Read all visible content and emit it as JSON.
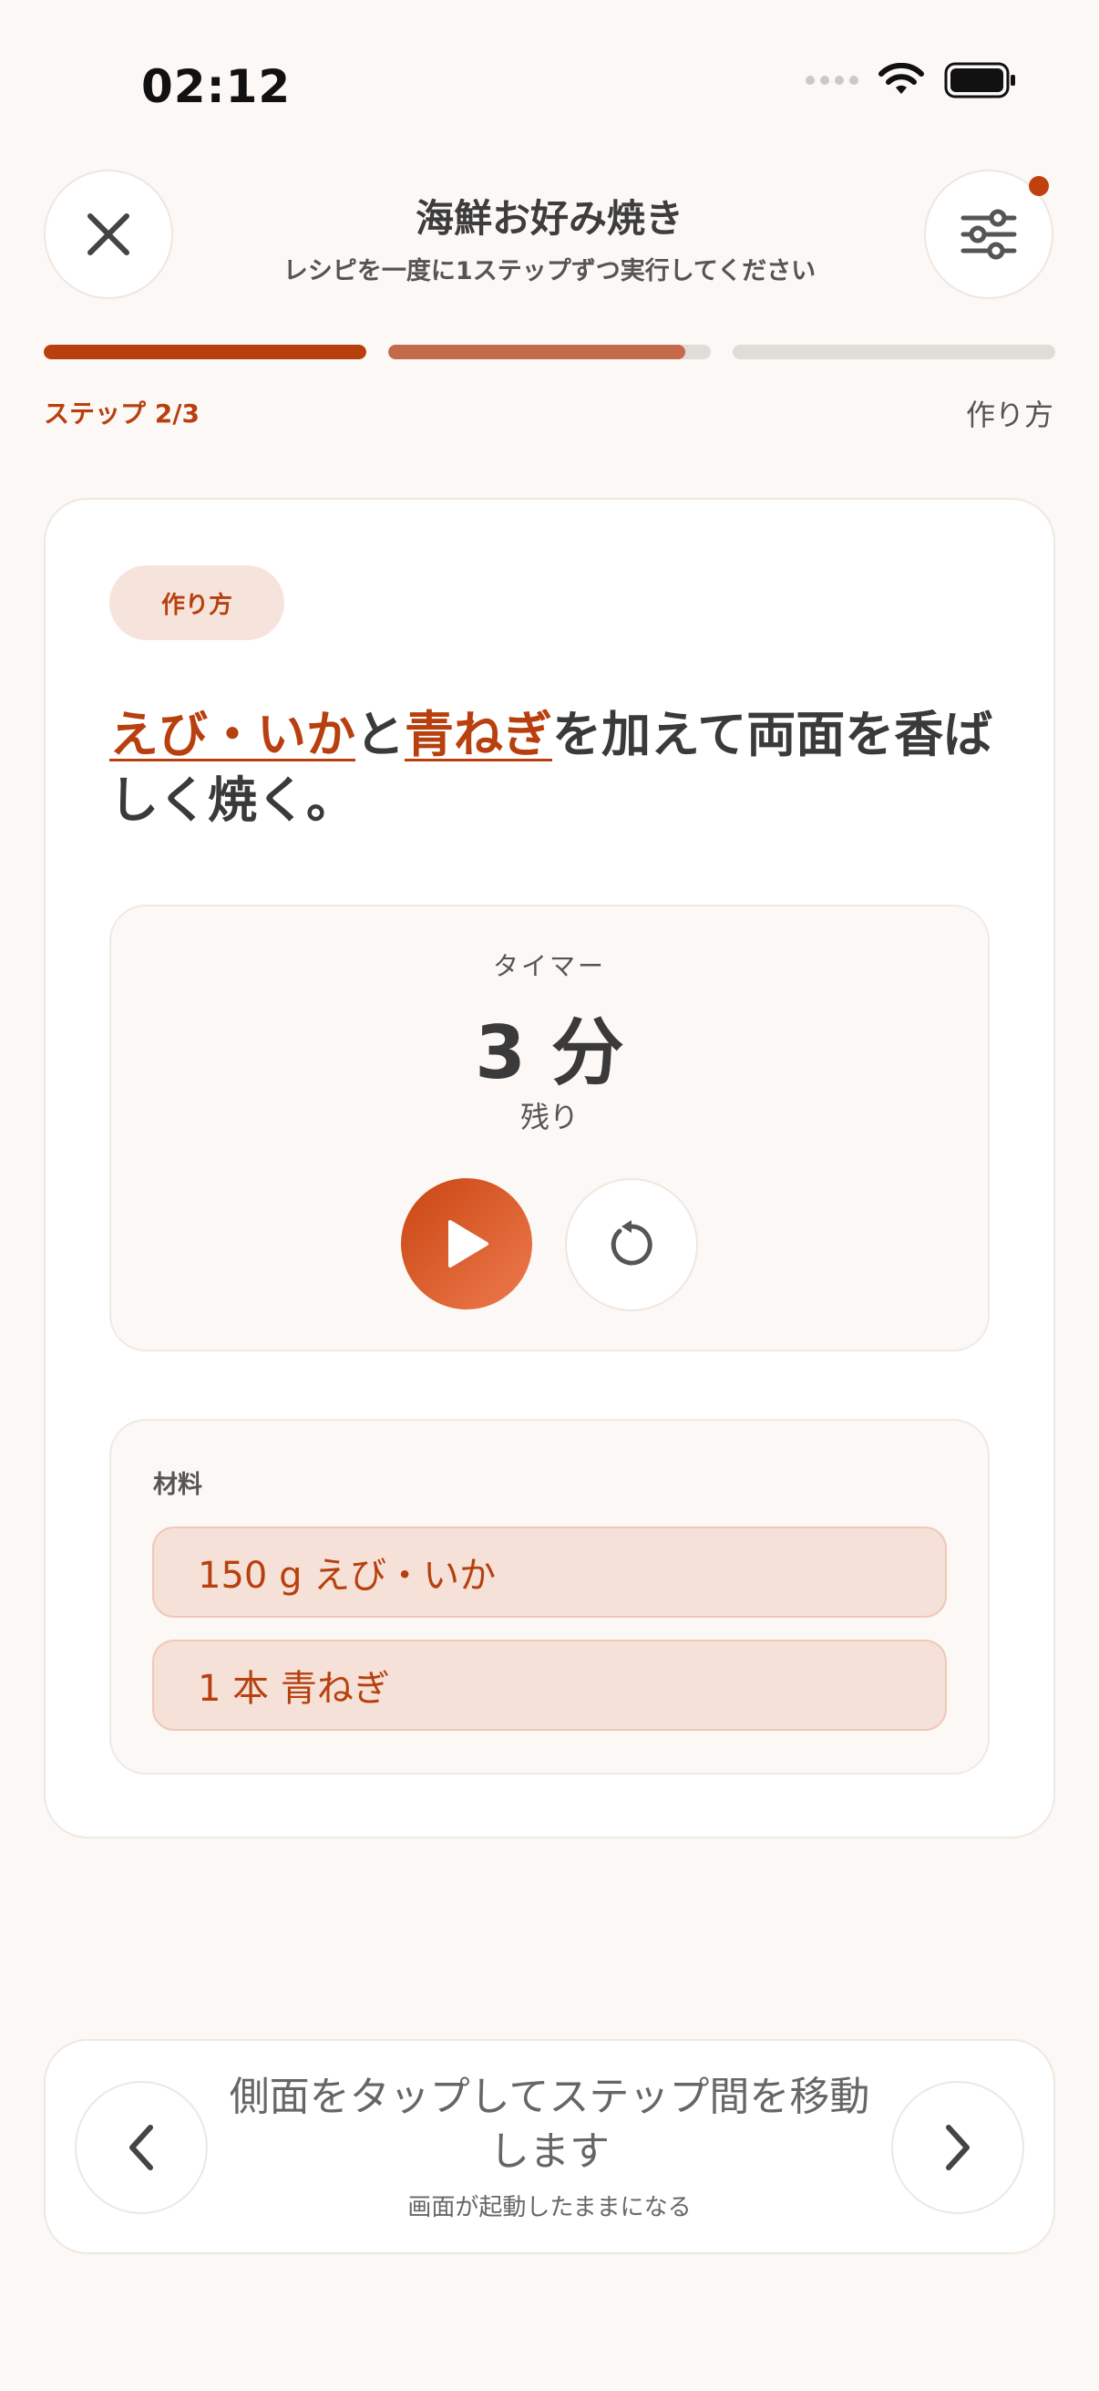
{
  "status_bar": {
    "time": "02:12"
  },
  "header": {
    "title": "海鮮お好み焼き",
    "subtitle": "レシピを一度に1ステップずつ実行してください",
    "close_icon": "close-icon",
    "settings_icon": "sliders-icon"
  },
  "progress": {
    "step_label": "ステップ 2/3",
    "section_label": "作り方",
    "segments": [
      {
        "fill": 1.0,
        "color": "#b8400f"
      },
      {
        "fill": 0.92,
        "color": "#c4694a"
      },
      {
        "fill": 0.0,
        "color": "#e0dcd8"
      }
    ]
  },
  "step": {
    "badge": "作り方",
    "instruction_parts": [
      {
        "text": "えび・いか",
        "highlight": true
      },
      {
        "text": "と",
        "highlight": false
      },
      {
        "text": "青ねぎ",
        "highlight": true
      },
      {
        "text": "を加えて両面を香ばしく焼く。",
        "highlight": false
      }
    ]
  },
  "timer": {
    "label": "タイマー",
    "value": "3 分",
    "remaining": "残り",
    "play_icon": "play-icon",
    "reset_icon": "reset-icon"
  },
  "ingredients": {
    "label": "材料",
    "items": [
      "150 g えび・いか",
      "1 本 青ねぎ"
    ]
  },
  "bottom": {
    "hint": "側面をタップしてステップ間を移動します",
    "subhint": "画面が起動したままになる",
    "prev_icon": "chevron-left-icon",
    "next_icon": "chevron-right-icon"
  },
  "colors": {
    "accent": "#b8400f",
    "background": "#fbf8f5"
  }
}
